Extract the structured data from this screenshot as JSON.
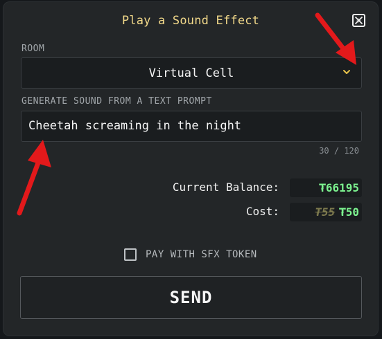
{
  "dialog": {
    "title": "Play a Sound Effect",
    "close_icon": "close-icon"
  },
  "room": {
    "label": "ROOM",
    "selected": "Virtual Cell",
    "chevron_icon": "chevron-down-icon"
  },
  "prompt": {
    "label": "GENERATE SOUND FROM A TEXT PROMPT",
    "value": "Cheetah screaming in the night",
    "counter": "30 / 120"
  },
  "balance": {
    "label": "Current Balance:",
    "value": "₮66195"
  },
  "cost": {
    "label": "Cost:",
    "original": "₮55",
    "discounted": "₮50"
  },
  "sfx_token": {
    "label": "PAY WITH SFX TOKEN",
    "checked": false
  },
  "send": {
    "label": "SEND"
  },
  "colors": {
    "title": "#f2d98a",
    "price_green": "#7cf28f",
    "chevron": "#e7c24a",
    "annotation_arrow": "#e3191b"
  }
}
